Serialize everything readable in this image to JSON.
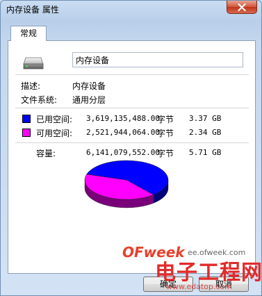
{
  "window": {
    "title": "内存设备 属性"
  },
  "tabs": [
    {
      "label": "常规"
    }
  ],
  "general": {
    "name_value": "内存设备",
    "description_label": "描述:",
    "description_value": "内存设备",
    "filesystem_label": "文件系统:",
    "filesystem_value": "通用分层"
  },
  "space": {
    "used": {
      "label": "已用空间:",
      "bytes": "3,619,135,488.00",
      "unit": "字节",
      "size": "3.37 GB",
      "color": "#0000ff"
    },
    "free": {
      "label": "可用空间:",
      "bytes": "2,521,944,064.00",
      "unit": "字节",
      "size": "2.34 GB",
      "color": "#ff00ff"
    },
    "capacity": {
      "label": "容量:",
      "bytes": "6,141,079,552.00",
      "unit": "字节",
      "size": "5.71 GB"
    }
  },
  "buttons": {
    "ok": "确定",
    "cancel": "取消"
  },
  "watermark": {
    "logo": "OFweek",
    "url": "ee.ofweek.com",
    "cn": "电子工程网",
    "url2": "www.edatop.com"
  },
  "icons": {
    "drive": "drive-icon",
    "close": "close-icon"
  }
}
